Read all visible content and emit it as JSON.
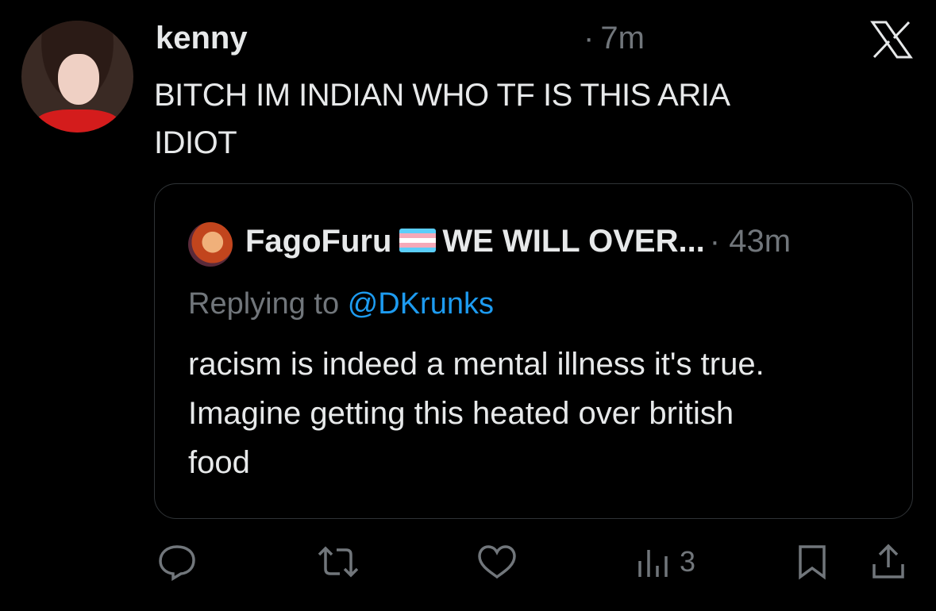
{
  "post": {
    "author_name": "kenny",
    "time_dot": "·",
    "time": "7m",
    "text_line1": "BITCH IM INDIAN WHO TF IS THIS ARIA",
    "text_line2": "IDIOT"
  },
  "quote": {
    "author_name": "FagoFuru",
    "author_suffix": "WE WILL OVER...",
    "time_dot": "·",
    "time": "43m",
    "replying_prefix": "Replying to",
    "replying_handle": "@DKrunks",
    "text_line1": "racism is indeed a mental illness it's true.",
    "text_line2": "Imagine getting this heated over british",
    "text_line3": "food"
  },
  "actions": {
    "views_count": "3",
    "icons": [
      "reply-icon",
      "repost-icon",
      "like-icon",
      "views-icon",
      "bookmark-icon",
      "share-icon"
    ]
  },
  "colors": {
    "background": "#000000",
    "text": "#e7e9ea",
    "muted": "#71767b",
    "link": "#1d9bf0",
    "border": "#2f3336"
  }
}
